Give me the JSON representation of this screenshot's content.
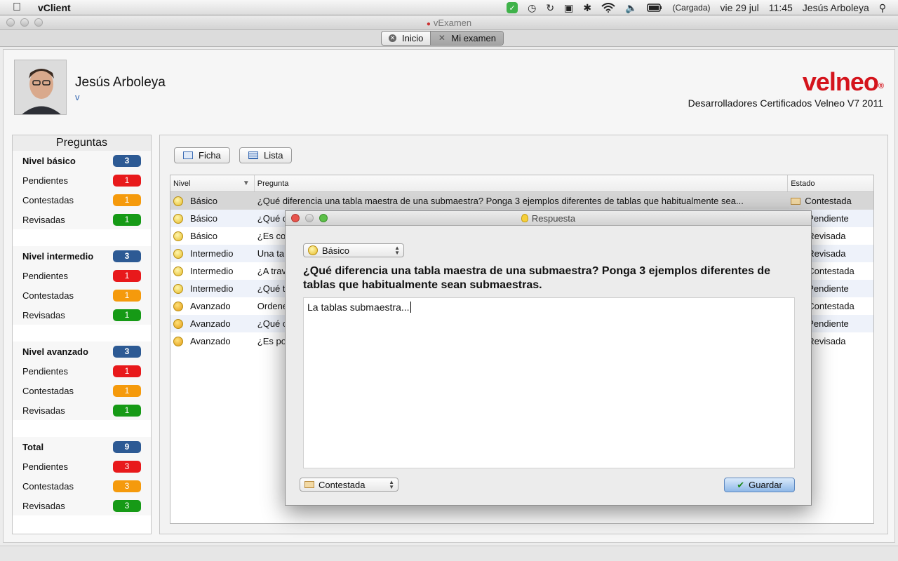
{
  "menubar": {
    "app_name": "vClient",
    "battery_status": "(Cargada)",
    "date": "vie 29 jul",
    "time": "11:45",
    "user": "Jesús Arboleya",
    "icons": [
      "apple-icon",
      "sync-badge-icon",
      "time-machine-icon",
      "refresh-icon",
      "display-icon",
      "bluetooth-icon",
      "wifi-icon",
      "volume-icon",
      "battery-icon",
      "spotlight-icon"
    ]
  },
  "window": {
    "title": "vExamen",
    "tabs": [
      {
        "label": "Inicio",
        "active": false
      },
      {
        "label": "Mi examen",
        "active": true
      }
    ]
  },
  "header": {
    "user_name": "Jesús Arboleya",
    "user_sub": "v",
    "logo": "velneo",
    "slogan": "Desarrolladores Certificados Velneo V7 2011"
  },
  "side": {
    "title": "Preguntas",
    "groups": [
      {
        "title": "Nivel básico",
        "total": "3",
        "rows": [
          {
            "label": "Pendientes",
            "value": "1"
          },
          {
            "label": "Contestadas",
            "value": "1"
          },
          {
            "label": "Revisadas",
            "value": "1"
          }
        ]
      },
      {
        "title": "Nivel intermedio",
        "total": "3",
        "rows": [
          {
            "label": "Pendientes",
            "value": "1"
          },
          {
            "label": "Contestadas",
            "value": "1"
          },
          {
            "label": "Revisadas",
            "value": "1"
          }
        ]
      },
      {
        "title": "Nivel avanzado",
        "total": "3",
        "rows": [
          {
            "label": "Pendientes",
            "value": "1"
          },
          {
            "label": "Contestadas",
            "value": "1"
          },
          {
            "label": "Revisadas",
            "value": "1"
          }
        ]
      },
      {
        "title": "Total",
        "total": "9",
        "rows": [
          {
            "label": "Pendientes",
            "value": "3"
          },
          {
            "label": "Contestadas",
            "value": "3"
          },
          {
            "label": "Revisadas",
            "value": "3"
          }
        ]
      }
    ],
    "colors": {
      "total": "#2d5a94",
      "pendientes": "#e8191b",
      "contestadas": "#f59a0c",
      "revisadas": "#169a16"
    }
  },
  "main": {
    "buttons": {
      "ficha": "Ficha",
      "lista": "Lista"
    },
    "columns": {
      "nivel": "Nivel",
      "pregunta": "Pregunta",
      "estado": "Estado"
    },
    "rows": [
      {
        "nivel": "Básico",
        "pregunta": "¿Qué diferencia una tabla maestra de una submaestra? Ponga 3 ejemplos diferentes de tablas que habitualmente sea...",
        "estado": "Contestada"
      },
      {
        "nivel": "Básico",
        "pregunta": "¿Qué d",
        "estado": "Pendiente"
      },
      {
        "nivel": "Básico",
        "pregunta": "¿Es co",
        "estado": "Revisada"
      },
      {
        "nivel": "Intermedio",
        "pregunta": "Una ta",
        "estado": "Revisada"
      },
      {
        "nivel": "Intermedio",
        "pregunta": "¿A trav",
        "estado": "Contestada"
      },
      {
        "nivel": "Intermedio",
        "pregunta": "¿Qué t",
        "estado": "Pendiente"
      },
      {
        "nivel": "Avanzado",
        "pregunta": "Ordene",
        "estado": "Contestada"
      },
      {
        "nivel": "Avanzado",
        "pregunta": "¿Qué c",
        "estado": "Pendiente"
      },
      {
        "nivel": "Avanzado",
        "pregunta": "¿Es po",
        "estado": "Revisada"
      }
    ]
  },
  "dialog": {
    "title": "Respuesta",
    "level": "Básico",
    "question": "¿Qué diferencia una tabla maestra de una submaestra? Ponga 3 ejemplos diferentes de tablas que habitualmente sean submaestras.",
    "answer": "La tablas submaestra...",
    "status": "Contestada",
    "save": "Guardar"
  }
}
